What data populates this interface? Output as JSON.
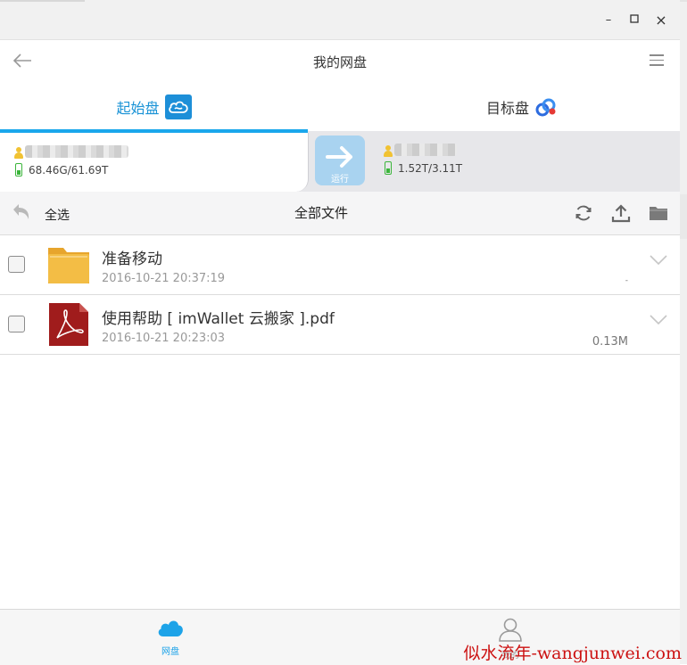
{
  "window": {
    "minimize": "–",
    "maximize": "☐",
    "close": "×"
  },
  "header": {
    "title": "我的网盘"
  },
  "disks": {
    "source": {
      "label": "起始盘",
      "size": "68.46G/61.69T"
    },
    "target": {
      "label": "目标盘",
      "size": "1.52T/3.11T"
    },
    "run_label": "运行"
  },
  "toolbar": {
    "select_all": "全选",
    "title": "全部文件"
  },
  "files": [
    {
      "name": "准备移动",
      "date": "2016-10-21 20:37:19",
      "size": "-",
      "type": "folder"
    },
    {
      "name": "使用帮助 [ imWallet 云搬家 ].pdf",
      "date": "2016-10-21 20:23:03",
      "size": "0.13M",
      "type": "pdf"
    }
  ],
  "bottom_nav": [
    {
      "label": "网盘",
      "icon": "cloud-icon",
      "active": true
    },
    {
      "label": "我的",
      "icon": "user-icon",
      "active": false
    }
  ],
  "watermark": "似水流年-wangjunwei.com",
  "colors": {
    "accent": "#1a93d6",
    "progress_bar": "#1aa7ec",
    "folder": "#f0b63c",
    "pdf": "#a01c1c"
  }
}
